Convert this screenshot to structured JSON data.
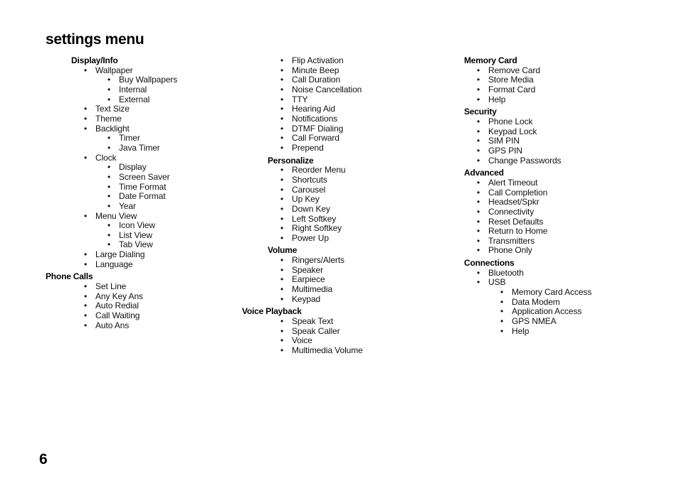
{
  "page": {
    "title": "settings menu",
    "page_number": "6"
  },
  "columns": [
    {
      "sections": [
        {
          "heading": "Display/Info",
          "items": [
            {
              "label": "Wallpaper",
              "children": [
                "Buy Wallpapers",
                "Internal",
                "External"
              ]
            },
            {
              "label": "Text Size",
              "children": []
            },
            {
              "label": "Theme",
              "children": []
            },
            {
              "label": "Backlight",
              "children": [
                "Timer",
                "Java Timer"
              ]
            },
            {
              "label": "Clock",
              "children": [
                "Display",
                "Screen Saver",
                "Time Format",
                "Date Format",
                "Year"
              ]
            },
            {
              "label": "Menu View",
              "children": [
                "Icon View",
                "List View",
                "Tab View"
              ]
            },
            {
              "label": "Large Dialing",
              "children": []
            },
            {
              "label": "Language",
              "children": []
            }
          ]
        },
        {
          "heading": "Phone Calls",
          "items": [
            {
              "label": "Set Line",
              "children": []
            },
            {
              "label": "Any Key Ans",
              "children": []
            },
            {
              "label": "Auto Redial",
              "children": []
            },
            {
              "label": "Call Waiting",
              "children": []
            },
            {
              "label": "Auto Ans",
              "children": []
            }
          ]
        }
      ]
    },
    {
      "sections": [
        {
          "heading": "",
          "items": [
            {
              "label": "Flip Activation",
              "children": []
            },
            {
              "label": "Minute Beep",
              "children": []
            },
            {
              "label": "Call Duration",
              "children": []
            },
            {
              "label": "Noise Cancellation",
              "children": []
            },
            {
              "label": "TTY",
              "children": []
            },
            {
              "label": "Hearing Aid",
              "children": []
            },
            {
              "label": "Notifications",
              "children": []
            },
            {
              "label": "DTMF Dialing",
              "children": []
            },
            {
              "label": "Call Forward",
              "children": []
            },
            {
              "label": "Prepend",
              "children": []
            }
          ]
        },
        {
          "heading": "Personalize",
          "items": [
            {
              "label": "Reorder Menu",
              "children": []
            },
            {
              "label": "Shortcuts",
              "children": []
            },
            {
              "label": "Carousel",
              "children": []
            },
            {
              "label": "Up Key",
              "children": []
            },
            {
              "label": "Down Key",
              "children": []
            },
            {
              "label": "Left Softkey",
              "children": []
            },
            {
              "label": "Right Softkey",
              "children": []
            },
            {
              "label": "Power Up",
              "children": []
            }
          ]
        },
        {
          "heading": "Volume",
          "items": [
            {
              "label": "Ringers/Alerts",
              "children": []
            },
            {
              "label": "Speaker",
              "children": []
            },
            {
              "label": "Earpiece",
              "children": []
            },
            {
              "label": "Multimedia",
              "children": []
            },
            {
              "label": "Keypad",
              "children": []
            }
          ]
        },
        {
          "heading": "Voice Playback",
          "items": [
            {
              "label": "Speak Text",
              "children": []
            },
            {
              "label": "Speak Caller",
              "children": []
            },
            {
              "label": "Voice",
              "children": []
            },
            {
              "label": "Multimedia Volume",
              "children": []
            }
          ]
        }
      ]
    },
    {
      "sections": [
        {
          "heading": "Memory Card",
          "items": [
            {
              "label": "Remove Card",
              "children": []
            },
            {
              "label": "Store Media",
              "children": []
            },
            {
              "label": "Format Card",
              "children": []
            },
            {
              "label": "Help",
              "children": []
            }
          ]
        },
        {
          "heading": "Security",
          "items": [
            {
              "label": "Phone Lock",
              "children": []
            },
            {
              "label": "Keypad Lock",
              "children": []
            },
            {
              "label": "SIM PIN",
              "children": []
            },
            {
              "label": "GPS PIN",
              "children": []
            },
            {
              "label": "Change Passwords",
              "children": []
            }
          ]
        },
        {
          "heading": "Advanced",
          "items": [
            {
              "label": "Alert Timeout",
              "children": []
            },
            {
              "label": "Call Completion",
              "children": []
            },
            {
              "label": "Headset/Spkr",
              "children": []
            },
            {
              "label": "Connectivity",
              "children": []
            },
            {
              "label": "Reset Defaults",
              "children": []
            },
            {
              "label": "Return to Home",
              "children": []
            },
            {
              "label": "Transmitters",
              "children": []
            },
            {
              "label": "Phone Only",
              "children": []
            }
          ]
        },
        {
          "heading": "Connections",
          "items": [
            {
              "label": "Bluetooth",
              "children": []
            },
            {
              "label": "USB",
              "children": [
                "Memory Card Access",
                "Data Modem",
                "Application Access",
                "GPS NMEA",
                "Help"
              ]
            }
          ]
        }
      ]
    }
  ]
}
